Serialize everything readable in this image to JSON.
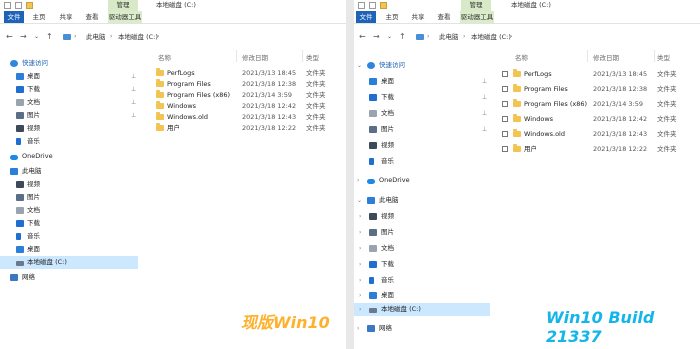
{
  "left": {
    "title": "本地磁盘 (C:)",
    "ribbon_context": "管理",
    "ribbon_tabs": [
      "文件",
      "主页",
      "共享",
      "查看",
      "驱动器工具"
    ],
    "address": [
      "此电脑",
      "本地磁盘 (C:)"
    ],
    "nav": [
      {
        "label": "快速访问",
        "icon": "quick-access-star-icon"
      },
      {
        "label": "桌面",
        "icon": "desktop-icon",
        "pinned": true
      },
      {
        "label": "下载",
        "icon": "download-arrow-icon",
        "pinned": true
      },
      {
        "label": "文档",
        "icon": "documents-icon",
        "pinned": true
      },
      {
        "label": "图片",
        "icon": "pictures-icon",
        "pinned": true
      },
      {
        "label": "视频",
        "icon": "videos-icon"
      },
      {
        "label": "音乐",
        "icon": "music-note-icon"
      },
      {
        "label": "OneDrive",
        "icon": "onedrive-cloud-icon"
      },
      {
        "label": "此电脑",
        "icon": "this-pc-icon"
      },
      {
        "label": "视频",
        "icon": "videos-icon"
      },
      {
        "label": "图片",
        "icon": "pictures-icon"
      },
      {
        "label": "文档",
        "icon": "documents-icon"
      },
      {
        "label": "下载",
        "icon": "download-arrow-icon"
      },
      {
        "label": "音乐",
        "icon": "music-note-icon"
      },
      {
        "label": "桌面",
        "icon": "desktop-icon"
      },
      {
        "label": "本地磁盘 (C:)",
        "icon": "drive-icon",
        "selected": true
      },
      {
        "label": "网络",
        "icon": "network-icon"
      }
    ],
    "columns": {
      "name": "名称",
      "date": "修改日期",
      "type": "类型"
    },
    "files": [
      {
        "name": "PerfLogs",
        "date": "2021/3/13 18:45",
        "type": "文件夹"
      },
      {
        "name": "Program Files",
        "date": "2021/3/18 12:38",
        "type": "文件夹"
      },
      {
        "name": "Program Files (x86)",
        "date": "2021/3/14 3:59",
        "type": "文件夹"
      },
      {
        "name": "Windows",
        "date": "2021/3/18 12:42",
        "type": "文件夹"
      },
      {
        "name": "Windows.old",
        "date": "2021/3/18 12:43",
        "type": "文件夹"
      },
      {
        "name": "用户",
        "date": "2021/3/18 12:22",
        "type": "文件夹"
      }
    ],
    "caption": "现版Win10"
  },
  "right": {
    "title": "本地磁盘 (C:)",
    "ribbon_context": "管理",
    "ribbon_tabs": [
      "文件",
      "主页",
      "共享",
      "查看",
      "驱动器工具"
    ],
    "address": [
      "此电脑",
      "本地磁盘 (C:)"
    ],
    "nav": [
      {
        "label": "快速访问",
        "icon": "quick-access-star-icon"
      },
      {
        "label": "桌面",
        "icon": "desktop-icon",
        "pinned": true
      },
      {
        "label": "下载",
        "icon": "download-arrow-icon",
        "pinned": true
      },
      {
        "label": "文档",
        "icon": "documents-icon",
        "pinned": true
      },
      {
        "label": "图片",
        "icon": "pictures-icon",
        "pinned": true
      },
      {
        "label": "视频",
        "icon": "videos-icon"
      },
      {
        "label": "音乐",
        "icon": "music-note-icon"
      },
      {
        "label": "OneDrive",
        "icon": "onedrive-cloud-icon"
      },
      {
        "label": "此电脑",
        "icon": "this-pc-icon"
      },
      {
        "label": "视频",
        "icon": "videos-icon"
      },
      {
        "label": "图片",
        "icon": "pictures-icon"
      },
      {
        "label": "文档",
        "icon": "documents-icon"
      },
      {
        "label": "下载",
        "icon": "download-arrow-icon"
      },
      {
        "label": "音乐",
        "icon": "music-note-icon"
      },
      {
        "label": "桌面",
        "icon": "desktop-icon"
      },
      {
        "label": "本地磁盘 (C:)",
        "icon": "drive-icon",
        "selected": true
      },
      {
        "label": "网络",
        "icon": "network-icon"
      }
    ],
    "columns": {
      "name": "名称",
      "date": "修改日期",
      "type": "类型"
    },
    "files": [
      {
        "name": "PerfLogs",
        "date": "2021/3/13 18:45",
        "type": "文件夹"
      },
      {
        "name": "Program Files",
        "date": "2021/3/18 12:38",
        "type": "文件夹"
      },
      {
        "name": "Program Files (x86)",
        "date": "2021/3/14 3:59",
        "type": "文件夹"
      },
      {
        "name": "Windows",
        "date": "2021/3/18 12:42",
        "type": "文件夹"
      },
      {
        "name": "Windows.old",
        "date": "2021/3/18 12:43",
        "type": "文件夹"
      },
      {
        "name": "用户",
        "date": "2021/3/18 12:22",
        "type": "文件夹"
      }
    ],
    "caption": "Win10 Build 21337"
  },
  "colors": {
    "ribbon_file_tab": "#1e63b8",
    "context_tab": "#d8e9c7",
    "selection": "#cce8ff",
    "folder": "#f2c451",
    "caption_left": "#ffb12e",
    "caption_right": "#14b5e9"
  }
}
